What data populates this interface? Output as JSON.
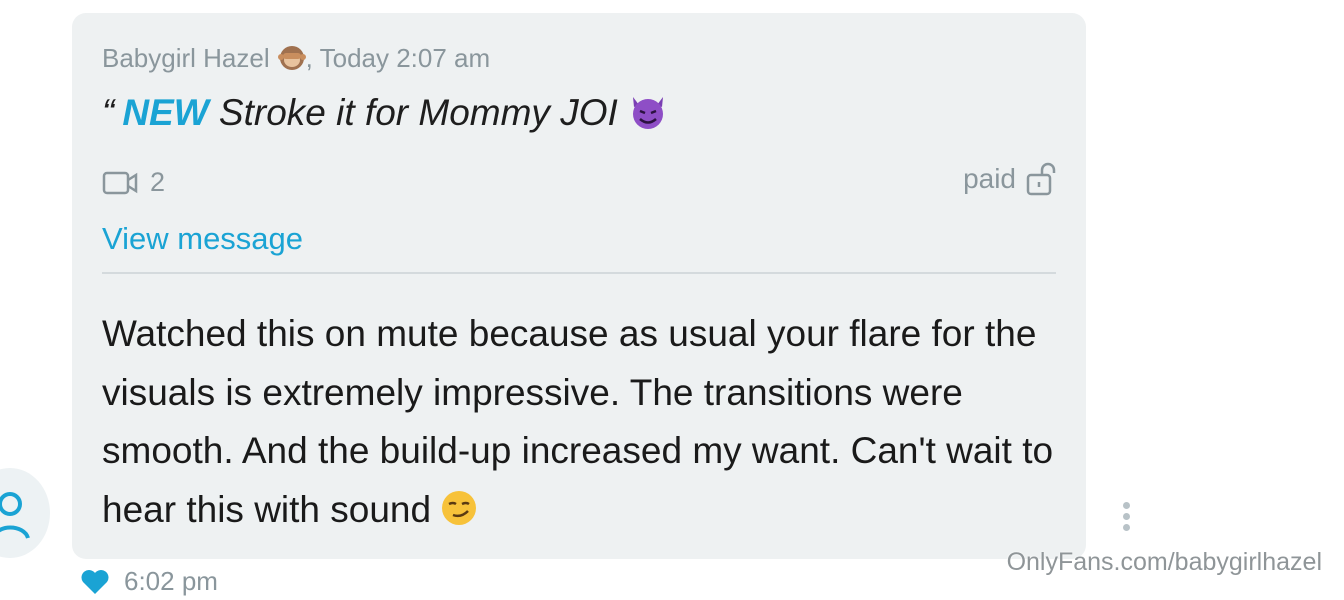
{
  "message": {
    "author": "Babygirl Hazel",
    "timestamp_prefix": ", Today 2:07 am",
    "quote_open": "“",
    "quote_new": "NEW",
    "quote_title": " Stroke it for Mommy JOI",
    "media_count": "2",
    "paid_label": "paid",
    "view_message_label": "View message",
    "body_text": "Watched this on mute because as usual your flare for the visuals is extremely impressive. The transitions were smooth. And the build-up increased my want. Can't wait to hear this with sound",
    "time": "6:02 pm"
  },
  "watermark": "OnlyFans.com/babygirlhazel",
  "colors": {
    "accent": "#1aa3d4",
    "bubble": "#eef1f2",
    "muted": "#8a969c"
  },
  "icons": {
    "author_emoji": "see-no-evil-monkey-icon",
    "title_emoji": "smiling-devil-icon",
    "body_emoji": "smirking-face-icon",
    "media": "video-camera-icon",
    "lock": "unlock-icon",
    "like": "heart-icon",
    "more": "vertical-dots-icon",
    "avatar": "user-icon"
  }
}
